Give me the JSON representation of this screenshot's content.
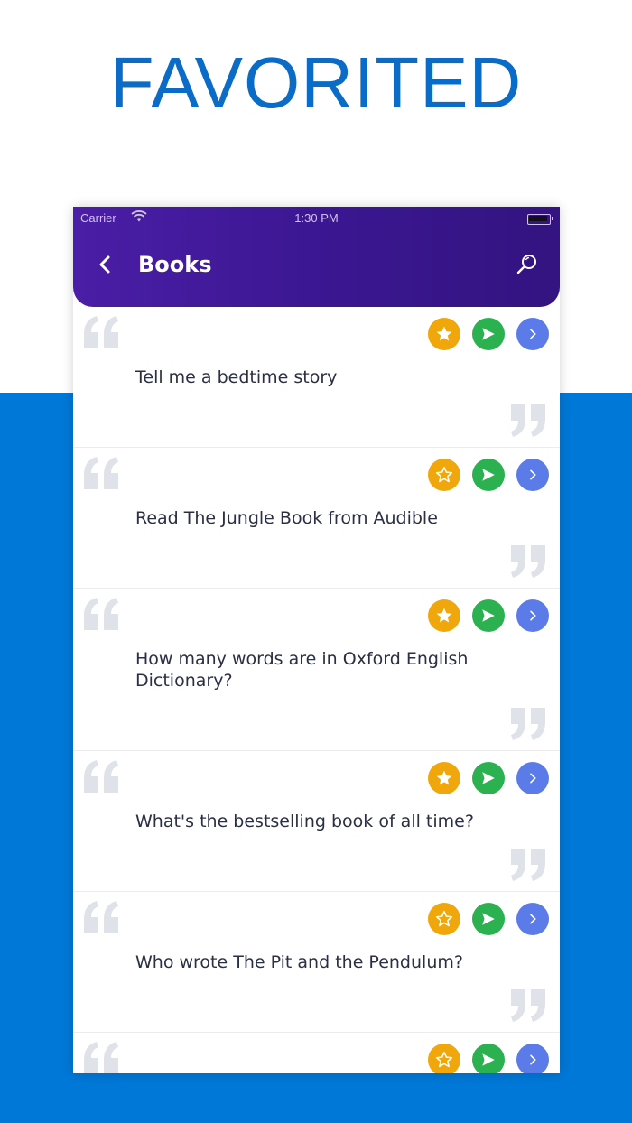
{
  "hero": {
    "title": "FAVORITED"
  },
  "status_bar": {
    "carrier": "Carrier",
    "time": "1:30 PM"
  },
  "navbar": {
    "title": "Books"
  },
  "items": [
    {
      "text": "Tell me a bedtime story",
      "favorited": true
    },
    {
      "text": "Read The Jungle Book from Audible",
      "favorited": false
    },
    {
      "text": "How many words are in Oxford English Dictionary?",
      "favorited": true
    },
    {
      "text": "What's the bestselling book of all time?",
      "favorited": true
    },
    {
      "text": "Who wrote The Pit and the Pendulum?",
      "favorited": false
    },
    {
      "text": "",
      "favorited": false
    }
  ],
  "colors": {
    "brand_blue": "#0078d7",
    "header_purple": "#4a1ea6",
    "favorite": "#f0a70c",
    "send": "#2bb14f",
    "open": "#5a7be8",
    "quote_marks": "#dfe2e8"
  },
  "icons": {
    "back": "chevron-left-icon",
    "search": "search-icon",
    "favorite": "star-icon",
    "send": "send-icon",
    "open": "chevron-right-icon",
    "quote_open": "quote-open-icon",
    "quote_close": "quote-close-icon"
  }
}
